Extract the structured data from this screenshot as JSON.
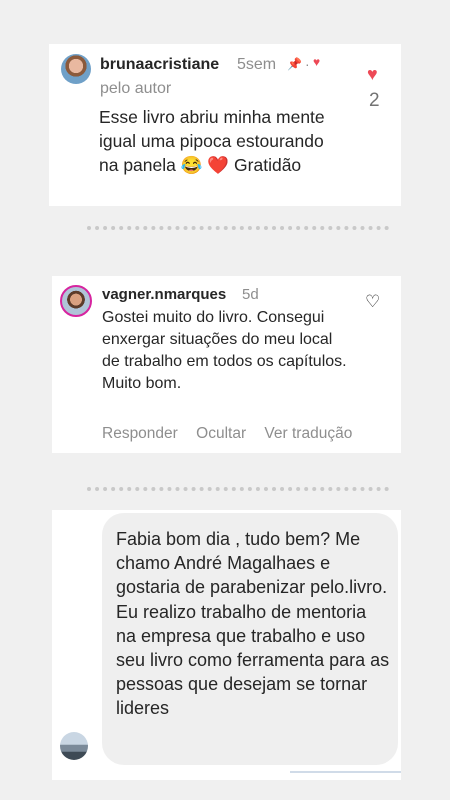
{
  "comments": [
    {
      "username": "brunaacristiane",
      "time": "5sem",
      "pinned_icon": "pin-icon",
      "author_liked_icon": "heart-icon",
      "by_author_label": "pelo autor",
      "text": "Esse livro abriu minha mente igual uma pipoca estourando na panela 😂 ❤️ Gratidão",
      "likes": "2"
    },
    {
      "username": "vagner.nmarques",
      "time": "5d",
      "text": "Gostei muito do livro. Consegui enxergar situações do meu local de trabalho em todos os capítulos. Muito bom.",
      "actions": [
        "Responder",
        "Ocultar",
        "Ver tradução"
      ]
    }
  ],
  "message": {
    "text": "Fabia bom dia , tudo bem? Me chamo André Magalhaes e gostaria de parabenizar pelo.livro. Eu realizo trabalho de mentoria na empresa que trabalho e uso seu livro como ferramenta para as pessoas que desejam se tornar lideres"
  },
  "colors": {
    "background": "#f0f0f0",
    "heart": "#ed4956",
    "muted_text": "#8e8e8e",
    "bubble": "#efefef"
  }
}
